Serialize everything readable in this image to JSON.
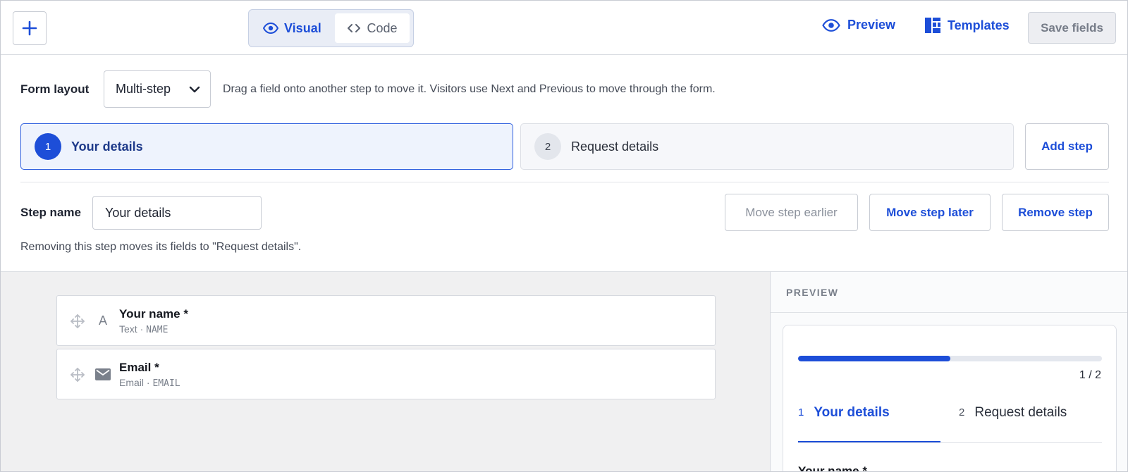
{
  "toolbar": {
    "add_label": "+",
    "visual_label": "Visual",
    "code_label": "Code",
    "preview_label": "Preview",
    "templates_label": "Templates",
    "save_label": "Save fields"
  },
  "form_layout": {
    "label": "Form layout",
    "selected": "Multi-step",
    "help": "Drag a field onto another step to move it. Visitors use Next and Previous to move through the form."
  },
  "steps": [
    {
      "number": "1",
      "name": "Your details",
      "active": true
    },
    {
      "number": "2",
      "name": "Request details",
      "active": false
    }
  ],
  "add_step_label": "Add step",
  "step_settings": {
    "name_label": "Step name",
    "name_value": "Your details",
    "move_earlier": "Move step earlier",
    "move_later": "Move step later",
    "remove": "Remove step",
    "remove_help": "Removing this step moves its fields to \"Request details\"."
  },
  "fields": [
    {
      "label": "Your name *",
      "type": "Text",
      "key": "NAME",
      "icon": "text-icon",
      "glyph": "A"
    },
    {
      "label": "Email *",
      "type": "Email",
      "key": "EMAIL",
      "icon": "envelope-icon"
    }
  ],
  "preview": {
    "title": "PREVIEW",
    "progress_text": "1 / 2",
    "progress_fraction": 0.5,
    "tabs": [
      {
        "number": "1",
        "label": "Your details"
      },
      {
        "number": "2",
        "label": "Request details"
      }
    ],
    "first_field_label": "Your name *"
  },
  "colors": {
    "accent": "#1d4ed8",
    "active_step_bg": "#eef3fd",
    "canvas_bg": "#f0f0f1"
  }
}
